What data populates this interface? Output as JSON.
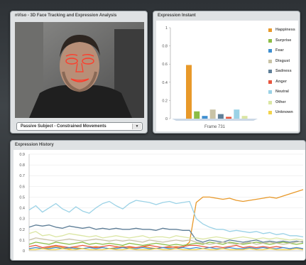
{
  "video_panel": {
    "title": "nViso - 3D Face Tracking and Expression Analysis",
    "dropdown_value": "Passive Subject - Constrained Movements",
    "dropdown_arrow": "▼"
  },
  "instant_panel": {
    "title": "Expression Instant",
    "legend": [
      {
        "label": "Happiness",
        "color": "#e8992a"
      },
      {
        "label": "Surprise",
        "color": "#8cbd45"
      },
      {
        "label": "Fear",
        "color": "#3f8fd0"
      },
      {
        "label": "Disgust",
        "color": "#c9c3a6"
      },
      {
        "label": "Sadness",
        "color": "#5f7f98"
      },
      {
        "label": "Anger",
        "color": "#e8553e"
      },
      {
        "label": "Neutral",
        "color": "#9bd2e6"
      },
      {
        "label": "Other",
        "color": "#dbe6a4"
      },
      {
        "label": "Unknown",
        "color": "#f2d34b"
      }
    ]
  },
  "history_panel": {
    "title": "Expression History"
  },
  "chart_data": [
    {
      "type": "bar",
      "title": "Expression Instant",
      "xlabel": "Frame 731",
      "categories": [
        "Happiness",
        "Surprise",
        "Fear",
        "Disgust",
        "Sadness",
        "Anger",
        "Neutral",
        "Other",
        "Unknown"
      ],
      "values": [
        0.59,
        0.08,
        0.03,
        0.1,
        0.05,
        0.02,
        0.1,
        0.03,
        0.0
      ],
      "ylim": [
        0,
        1
      ],
      "yticks": [
        "0",
        "0.2",
        "0.4",
        "0.6",
        "0.8",
        "1"
      ]
    },
    {
      "type": "line",
      "title": "Expression History",
      "ylim": [
        0,
        0.9
      ],
      "yticks": [
        "0",
        "0.1",
        "0.2",
        "0.3",
        "0.4",
        "0.5",
        "0.6",
        "0.7",
        "0.8",
        "0.9"
      ],
      "grid": true,
      "series": [
        {
          "color": "#e8992a",
          "values": [
            0.02,
            0.03,
            0.02,
            0.03,
            0.04,
            0.03,
            0.02,
            0.03,
            0.02,
            0.03,
            0.04,
            0.03,
            0.02,
            0.03,
            0.04,
            0.03,
            0.03,
            0.04,
            0.03,
            0.02,
            0.03,
            0.03,
            0.04,
            0.03,
            0.08,
            0.45,
            0.5,
            0.5,
            0.49,
            0.48,
            0.49,
            0.47,
            0.46,
            0.47,
            0.48,
            0.49,
            0.5,
            0.49,
            0.51,
            0.53,
            0.55,
            0.57
          ]
        },
        {
          "color": "#9bd2e6",
          "values": [
            0.38,
            0.42,
            0.36,
            0.4,
            0.44,
            0.39,
            0.36,
            0.41,
            0.37,
            0.35,
            0.4,
            0.44,
            0.46,
            0.42,
            0.39,
            0.44,
            0.47,
            0.46,
            0.45,
            0.43,
            0.45,
            0.46,
            0.44,
            0.45,
            0.46,
            0.3,
            0.25,
            0.22,
            0.2,
            0.2,
            0.18,
            0.19,
            0.18,
            0.17,
            0.18,
            0.16,
            0.17,
            0.15,
            0.16,
            0.14,
            0.14,
            0.13
          ]
        },
        {
          "color": "#5f7f98",
          "values": [
            0.22,
            0.24,
            0.23,
            0.24,
            0.22,
            0.21,
            0.23,
            0.22,
            0.21,
            0.22,
            0.2,
            0.21,
            0.2,
            0.21,
            0.2,
            0.2,
            0.21,
            0.2,
            0.2,
            0.19,
            0.21,
            0.2,
            0.2,
            0.19,
            0.19,
            0.1,
            0.08,
            0.1,
            0.09,
            0.08,
            0.1,
            0.09,
            0.08,
            0.09,
            0.1,
            0.08,
            0.09,
            0.08,
            0.09,
            0.08,
            0.09,
            0.08
          ]
        },
        {
          "color": "#dbe6a4",
          "values": [
            0.16,
            0.18,
            0.14,
            0.15,
            0.13,
            0.14,
            0.16,
            0.15,
            0.14,
            0.13,
            0.14,
            0.12,
            0.13,
            0.14,
            0.13,
            0.12,
            0.13,
            0.14,
            0.12,
            0.13,
            0.13,
            0.12,
            0.14,
            0.13,
            0.12,
            0.12,
            0.11,
            0.12,
            0.13,
            0.12,
            0.11,
            0.12,
            0.13,
            0.12,
            0.11,
            0.12,
            0.11,
            0.12,
            0.11,
            0.1,
            0.11,
            0.1
          ]
        },
        {
          "color": "#8cbd45",
          "values": [
            0.06,
            0.08,
            0.07,
            0.06,
            0.08,
            0.07,
            0.06,
            0.07,
            0.08,
            0.06,
            0.07,
            0.06,
            0.07,
            0.06,
            0.05,
            0.07,
            0.06,
            0.05,
            0.06,
            0.07,
            0.06,
            0.05,
            0.06,
            0.05,
            0.06,
            0.07,
            0.06,
            0.08,
            0.07,
            0.06,
            0.08,
            0.07,
            0.06,
            0.07,
            0.08,
            0.07,
            0.06,
            0.07,
            0.08,
            0.07,
            0.06,
            0.07
          ]
        },
        {
          "color": "#c9c3a6",
          "values": [
            0.1,
            0.12,
            0.11,
            0.1,
            0.09,
            0.1,
            0.11,
            0.1,
            0.09,
            0.1,
            0.11,
            0.1,
            0.09,
            0.1,
            0.09,
            0.1,
            0.09,
            0.08,
            0.1,
            0.09,
            0.08,
            0.09,
            0.1,
            0.09,
            0.1,
            0.08,
            0.07,
            0.06,
            0.07,
            0.08,
            0.07,
            0.06,
            0.07,
            0.08,
            0.06,
            0.07,
            0.08,
            0.07,
            0.06,
            0.07,
            0.08,
            0.09
          ]
        },
        {
          "color": "#e8553e",
          "values": [
            0.04,
            0.05,
            0.03,
            0.04,
            0.05,
            0.04,
            0.03,
            0.04,
            0.05,
            0.04,
            0.03,
            0.04,
            0.05,
            0.04,
            0.03,
            0.04,
            0.03,
            0.04,
            0.05,
            0.04,
            0.03,
            0.04,
            0.03,
            0.04,
            0.05,
            0.05,
            0.04,
            0.03,
            0.04,
            0.03,
            0.04,
            0.05,
            0.03,
            0.04,
            0.03,
            0.04,
            0.03,
            0.04,
            0.03,
            0.02,
            0.03,
            0.02
          ]
        },
        {
          "color": "#3f8fd0",
          "values": [
            0.02,
            0.03,
            0.02,
            0.02,
            0.03,
            0.02,
            0.03,
            0.02,
            0.02,
            0.03,
            0.02,
            0.03,
            0.02,
            0.02,
            0.03,
            0.02,
            0.02,
            0.03,
            0.02,
            0.02,
            0.03,
            0.02,
            0.02,
            0.03,
            0.02,
            0.03,
            0.02,
            0.03,
            0.02,
            0.02,
            0.03,
            0.02,
            0.02,
            0.03,
            0.02,
            0.03,
            0.02,
            0.02,
            0.03,
            0.02,
            0.03,
            0.02
          ]
        },
        {
          "color": "#f2d34b",
          "values": [
            0.01,
            0.01,
            0.02,
            0.01,
            0.01,
            0.02,
            0.01,
            0.01,
            0.02,
            0.01,
            0.01,
            0.01,
            0.02,
            0.01,
            0.01,
            0.02,
            0.01,
            0.01,
            0.01,
            0.02,
            0.01,
            0.01,
            0.02,
            0.01,
            0.01,
            0.01,
            0.02,
            0.01,
            0.01,
            0.02,
            0.01,
            0.01,
            0.01,
            0.02,
            0.01,
            0.01,
            0.02,
            0.01,
            0.01,
            0.01,
            0.02,
            0.01
          ]
        }
      ]
    }
  ]
}
